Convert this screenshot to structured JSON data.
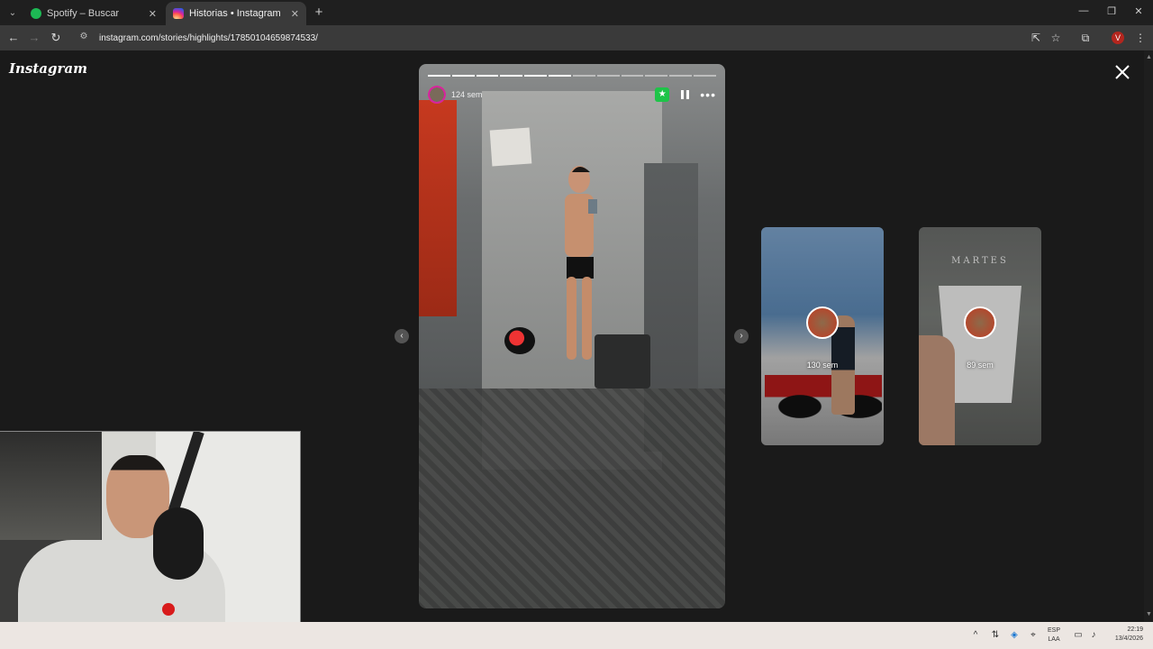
{
  "browser": {
    "tabs": [
      {
        "title": "Spotify – Buscar",
        "icon": "spotify-icon",
        "active": false
      },
      {
        "title": "Historias • Instagram",
        "icon": "instagram-icon",
        "active": true
      }
    ],
    "url": "instagram.com/stories/highlights/17850104659874533/"
  },
  "page": {
    "logo": "Instagram",
    "story": {
      "time": "124 sem",
      "segments_total": 12,
      "segments_done": 6
    },
    "previews": [
      {
        "time": "130 sem",
        "caption": ""
      },
      {
        "time": "89 sem",
        "brand": "MARTES"
      }
    ]
  },
  "taskbar": {
    "lang_top": "ESP",
    "lang_bottom": "LAA",
    "time": "22:19",
    "date": "13/4/2026"
  },
  "colors": {
    "page_bg": "#1a1a1a",
    "favorite_badge": "#1ec448",
    "tab_active": "#3a3a3a"
  }
}
